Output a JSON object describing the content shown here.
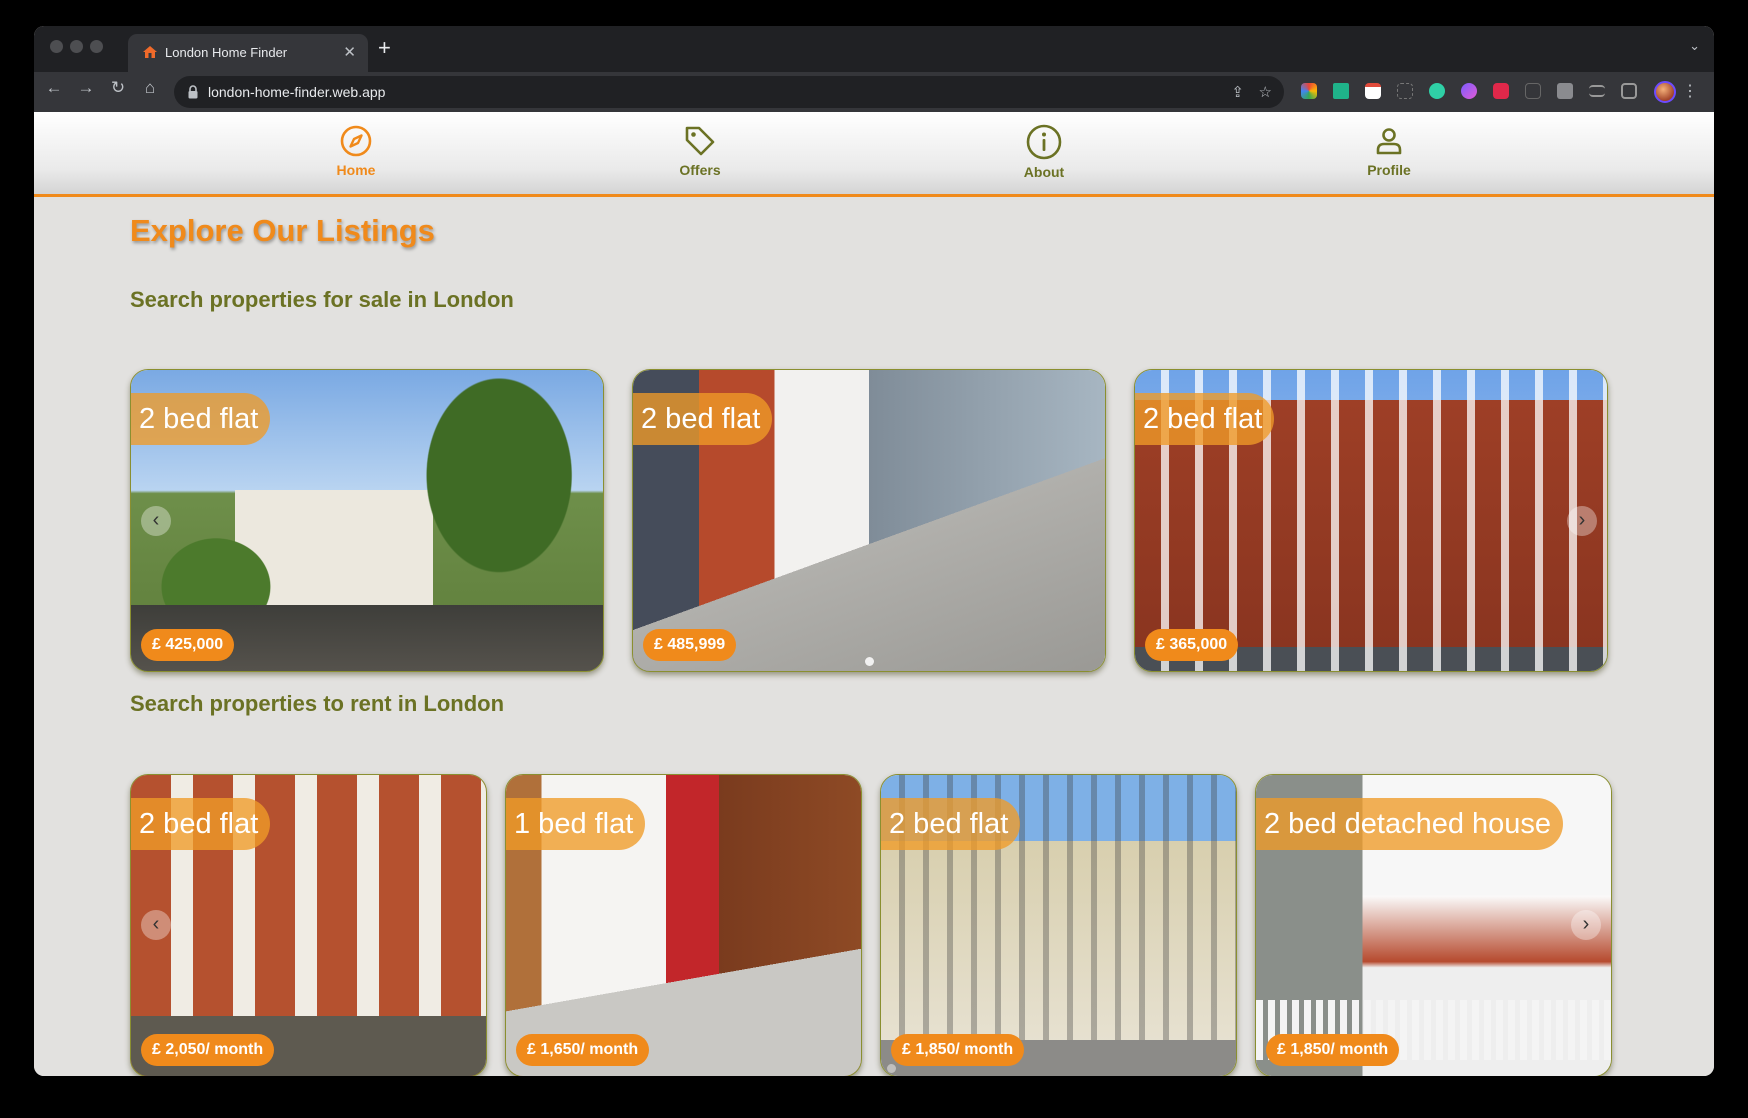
{
  "browser": {
    "tab_title": "London Home Finder",
    "url": "london-home-finder.web.app",
    "new_tab": "+",
    "tab_close": "✕"
  },
  "nav": {
    "items": [
      {
        "label": "Home",
        "icon": "compass-icon",
        "active": true
      },
      {
        "label": "Offers",
        "icon": "tag-icon",
        "active": false
      },
      {
        "label": "About",
        "icon": "info-icon",
        "active": false
      },
      {
        "label": "Profile",
        "icon": "person-icon",
        "active": false
      }
    ]
  },
  "page": {
    "title": "Explore Our Listings",
    "sale_heading": "Search properties for sale in London",
    "rent_heading": "Search properties to rent in London"
  },
  "sale_listings": [
    {
      "type": "2 bed flat",
      "price": "£ 425,000"
    },
    {
      "type": "2 bed flat",
      "price": "£ 485,999"
    },
    {
      "type": "2 bed flat",
      "price": "£ 365,000"
    }
  ],
  "rent_listings": [
    {
      "type": "2 bed flat",
      "price": "£ 2,050/ month"
    },
    {
      "type": "1 bed flat",
      "price": "£ 1,650/ month"
    },
    {
      "type": "2 bed flat",
      "price": "£ 1,850/ month"
    },
    {
      "type": "2 bed detached house",
      "price": "£ 1,850/ month"
    }
  ],
  "carousel": {
    "prev": "‹",
    "next": "›"
  },
  "colors": {
    "accent": "#f08a1b",
    "olive": "#6b7224",
    "background": "#e2e1df"
  }
}
